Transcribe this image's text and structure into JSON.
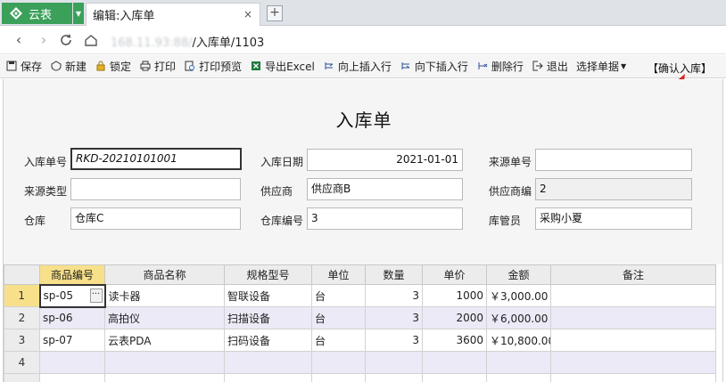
{
  "app": {
    "name": "云表",
    "brand_color": "#3aa05a"
  },
  "tab": {
    "title": "编辑:入库单",
    "close": "×",
    "new_tab": "+"
  },
  "address": {
    "blurred_host": "168.11.93:88/",
    "path": "/入库单/1103"
  },
  "toolbar": {
    "items": [
      {
        "label": "保存",
        "icon": "save-icon"
      },
      {
        "label": "新建",
        "icon": "new-icon"
      },
      {
        "label": "锁定",
        "icon": "lock-icon"
      },
      {
        "label": "打印",
        "icon": "print-icon"
      },
      {
        "label": "打印预览",
        "icon": "print-preview-icon"
      },
      {
        "label": "导出Excel",
        "icon": "excel-icon"
      },
      {
        "label": "向上插入行",
        "icon": "insert-above-icon"
      },
      {
        "label": "向下插入行",
        "icon": "insert-below-icon"
      },
      {
        "label": "删除行",
        "icon": "delete-row-icon"
      },
      {
        "label": "退出",
        "icon": "exit-icon"
      },
      {
        "label": "选择单据",
        "icon": "dropdown-caret-icon"
      }
    ],
    "confirm": "【确认入库】"
  },
  "form": {
    "title": "入库单",
    "fields": {
      "inbound_no": {
        "label": "入库单号",
        "value": "RKD-20210101001"
      },
      "inbound_date": {
        "label": "入库日期",
        "value": "2021-01-01"
      },
      "source_no": {
        "label": "来源单号",
        "value": ""
      },
      "source_type": {
        "label": "来源类型",
        "value": ""
      },
      "supplier": {
        "label": "供应商",
        "value": "供应商B"
      },
      "supplier_code": {
        "label": "供应商编",
        "value": "2"
      },
      "warehouse": {
        "label": "仓库",
        "value": "仓库C"
      },
      "warehouse_code": {
        "label": "仓库编号",
        "value": "3"
      },
      "keeper": {
        "label": "库管员",
        "value": "采购小夏"
      }
    }
  },
  "grid": {
    "headers": [
      "商品编号",
      "商品名称",
      "规格型号",
      "单位",
      "数量",
      "单价",
      "金额",
      "备注"
    ],
    "rows": [
      {
        "no": "1",
        "code": "sp-05",
        "name": "读卡器",
        "spec": "智联设备",
        "unit": "台",
        "qty": "3",
        "price": "1000",
        "amount": "￥3,000.00",
        "note": ""
      },
      {
        "no": "2",
        "code": "sp-06",
        "name": "高拍仪",
        "spec": "扫描设备",
        "unit": "台",
        "qty": "3",
        "price": "2000",
        "amount": "￥6,000.00",
        "note": ""
      },
      {
        "no": "3",
        "code": "sp-07",
        "name": "云表PDA",
        "spec": "扫码设备",
        "unit": "台",
        "qty": "3",
        "price": "3600",
        "amount": "￥10,800.00",
        "note": ""
      },
      {
        "no": "4",
        "code": "",
        "name": "",
        "spec": "",
        "unit": "",
        "qty": "",
        "price": "",
        "amount": "",
        "note": ""
      }
    ],
    "ellipsis": "···"
  },
  "annotation": {
    "arrow_color": "#e02020"
  }
}
